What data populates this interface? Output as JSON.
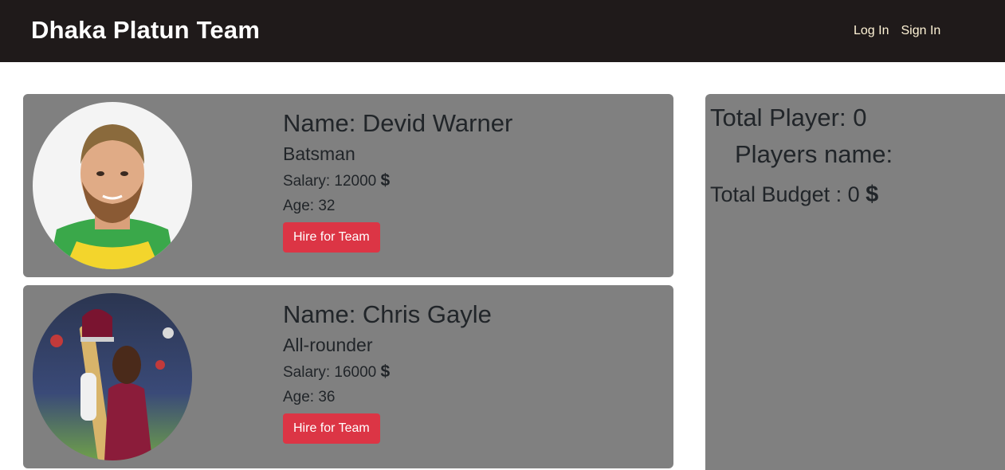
{
  "navbar": {
    "brand": "Dhaka Platun Team",
    "links": [
      "Log In",
      "Sign In"
    ]
  },
  "players": [
    {
      "name_label": "Name: Devid Warner",
      "role": "Batsman",
      "salary_label": "Salary: 12000",
      "age_label": "Age: 32",
      "hire_label": "Hire for Team"
    },
    {
      "name_label": "Name: Chris Gayle",
      "role": "All-rounder",
      "salary_label": "Salary: 16000",
      "age_label": "Age: 36",
      "hire_label": "Hire for Team"
    }
  ],
  "currency_symbol": "$",
  "cart": {
    "total_player_label": "Total Player: 0",
    "players_name_label": "Players name:",
    "total_budget_label": "Total Budget : 0"
  },
  "colors": {
    "navbar_bg": "#1f1a1a",
    "card_bg": "#808080",
    "button_bg": "#dc3545",
    "nav_link": "#fff3d6"
  }
}
